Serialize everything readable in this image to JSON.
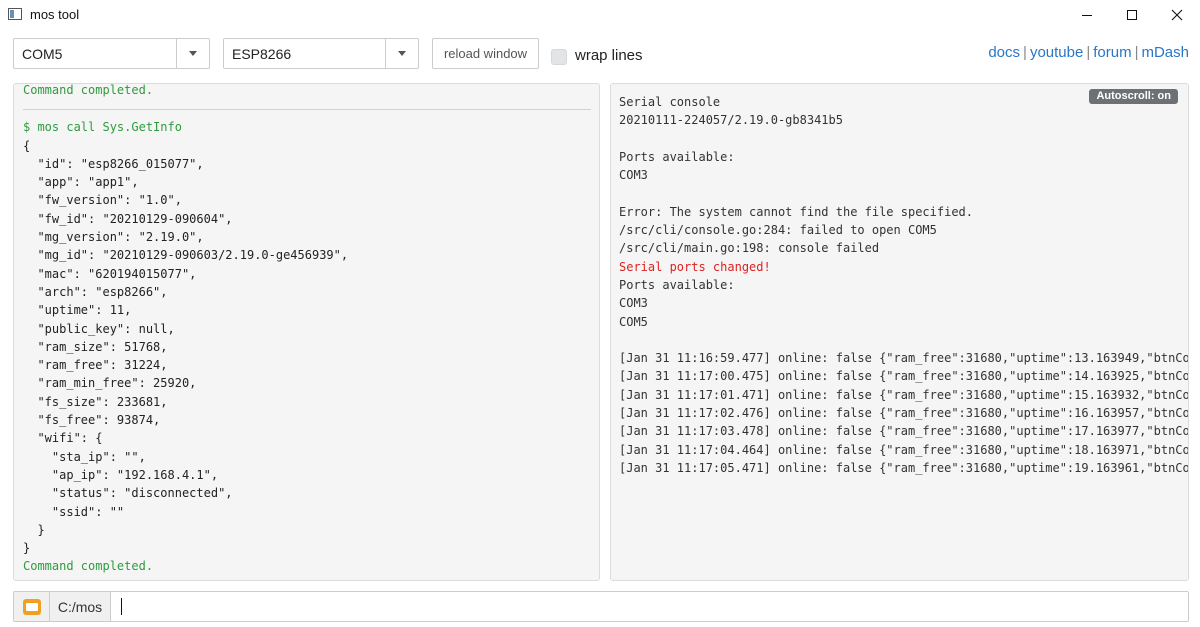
{
  "window": {
    "title": "mos tool"
  },
  "toolbar": {
    "port_value": "COM5",
    "board_value": "ESP8266",
    "reload_label": "reload window",
    "wrap_label": "wrap lines",
    "wrap_checked": false
  },
  "links": {
    "docs": "docs",
    "youtube": "youtube",
    "forum": "forum",
    "mdash": "mDash",
    "separator": "|"
  },
  "left_panel": {
    "top_line": "Command completed.",
    "command": "$ mos call Sys.GetInfo",
    "output_lines": [
      "{",
      "  \"id\": \"esp8266_015077\",",
      "  \"app\": \"app1\",",
      "  \"fw_version\": \"1.0\",",
      "  \"fw_id\": \"20210129-090604\",",
      "  \"mg_version\": \"2.19.0\",",
      "  \"mg_id\": \"20210129-090603/2.19.0-ge456939\",",
      "  \"mac\": \"620194015077\",",
      "  \"arch\": \"esp8266\",",
      "  \"uptime\": 11,",
      "  \"public_key\": null,",
      "  \"ram_size\": 51768,",
      "  \"ram_free\": 31224,",
      "  \"ram_min_free\": 25920,",
      "  \"fs_size\": 233681,",
      "  \"fs_free\": 93874,",
      "  \"wifi\": {",
      "    \"sta_ip\": \"\",",
      "    \"ap_ip\": \"192.168.4.1\",",
      "    \"status\": \"disconnected\",",
      "    \"ssid\": \"\"",
      "  }",
      "}"
    ],
    "bottom_line": "Command completed."
  },
  "right_panel": {
    "autoscroll_label": "Autoscroll: on",
    "lines": [
      {
        "text": "Serial console",
        "color": "normal"
      },
      {
        "text": "20210111-224057/2.19.0-gb8341b5",
        "color": "normal"
      },
      {
        "text": "",
        "color": "normal"
      },
      {
        "text": "Ports available:",
        "color": "normal"
      },
      {
        "text": "COM3",
        "color": "normal"
      },
      {
        "text": "",
        "color": "normal"
      },
      {
        "text": "Error: The system cannot find the file specified.",
        "color": "normal"
      },
      {
        "text": "/src/cli/console.go:284: failed to open COM5",
        "color": "normal"
      },
      {
        "text": "/src/cli/main.go:198: console failed",
        "color": "normal"
      },
      {
        "text": "Serial ports changed!",
        "color": "red"
      },
      {
        "text": "Ports available:",
        "color": "normal"
      },
      {
        "text": "COM3",
        "color": "normal"
      },
      {
        "text": "COM5",
        "color": "normal"
      },
      {
        "text": "",
        "color": "normal"
      },
      {
        "text": "[Jan 31 11:16:59.477] online: false {\"ram_free\":31680,\"uptime\":13.163949,\"btnCou",
        "color": "normal"
      },
      {
        "text": "[Jan 31 11:17:00.475] online: false {\"ram_free\":31680,\"uptime\":14.163925,\"btnCou",
        "color": "normal"
      },
      {
        "text": "[Jan 31 11:17:01.471] online: false {\"ram_free\":31680,\"uptime\":15.163932,\"btnCou",
        "color": "normal"
      },
      {
        "text": "[Jan 31 11:17:02.476] online: false {\"ram_free\":31680,\"uptime\":16.163957,\"btnCou",
        "color": "normal"
      },
      {
        "text": "[Jan 31 11:17:03.478] online: false {\"ram_free\":31680,\"uptime\":17.163977,\"btnCou",
        "color": "normal"
      },
      {
        "text": "[Jan 31 11:17:04.464] online: false {\"ram_free\":31680,\"uptime\":18.163971,\"btnCou",
        "color": "normal"
      },
      {
        "text": "[Jan 31 11:17:05.471] online: false {\"ram_free\":31680,\"uptime\":19.163961,\"btnCou",
        "color": "normal"
      }
    ]
  },
  "command_bar": {
    "folder_icon": "folder-icon",
    "cwd": "C:/mos",
    "input_value": ""
  },
  "colors": {
    "link": "#2a76c6",
    "success": "#2e9b3e",
    "error": "#dd2222",
    "badge": "#6d7175"
  }
}
